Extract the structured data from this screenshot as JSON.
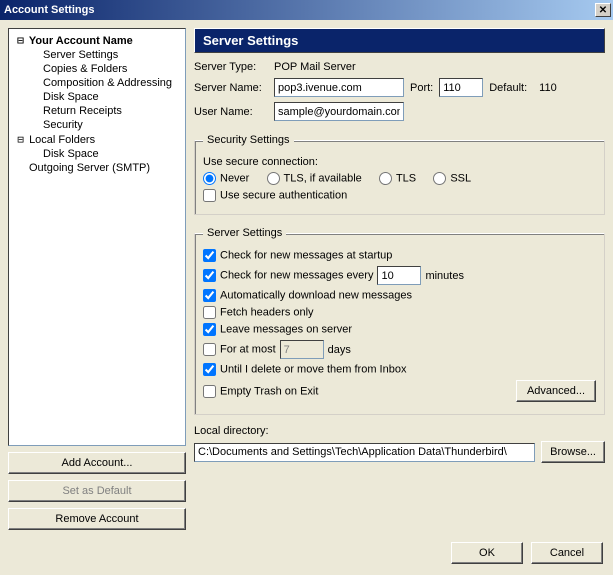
{
  "title": "Account Settings",
  "tree": {
    "account_name": "Your Account Name",
    "items": [
      "Server Settings",
      "Copies & Folders",
      "Composition & Addressing",
      "Disk Space",
      "Return Receipts",
      "Security"
    ],
    "local_folders": "Local Folders",
    "local_items": [
      "Disk Space"
    ],
    "smtp": "Outgoing Server (SMTP)"
  },
  "left_buttons": {
    "add": "Add Account...",
    "set_default": "Set as Default",
    "remove": "Remove Account"
  },
  "panel": {
    "title": "Server Settings",
    "server_type_lab": "Server Type:",
    "server_type_val": "POP Mail Server",
    "server_name_lab": "Server Name:",
    "server_name_val": "pop3.ivenue.com",
    "port_lab": "Port:",
    "port_val": "110",
    "default_lab": "Default:",
    "default_val": "110",
    "user_name_lab": "User Name:",
    "user_name_val": "sample@yourdomain.com"
  },
  "security": {
    "legend": "Security Settings",
    "use_secure_lab": "Use secure connection:",
    "never": "Never",
    "tls_avail": "TLS, if available",
    "tls": "TLS",
    "ssl": "SSL",
    "secure_auth": "Use secure authentication"
  },
  "server": {
    "legend": "Server Settings",
    "check_startup": "Check for new messages at startup",
    "check_every_a": "Check for new messages every",
    "check_every_val": "10",
    "check_every_b": "minutes",
    "auto_download": "Automatically download new messages",
    "fetch_headers": "Fetch headers only",
    "leave_server": "Leave messages on server",
    "for_at_most_a": "For at most",
    "for_at_most_val": "7",
    "for_at_most_b": "days",
    "until_delete": "Until I delete or move them from Inbox",
    "empty_trash": "Empty Trash on Exit",
    "advanced": "Advanced..."
  },
  "localdir": {
    "label": "Local directory:",
    "value": "C:\\Documents and Settings\\Tech\\Application Data\\Thunderbird\\",
    "browse": "Browse..."
  },
  "footer": {
    "ok": "OK",
    "cancel": "Cancel"
  }
}
